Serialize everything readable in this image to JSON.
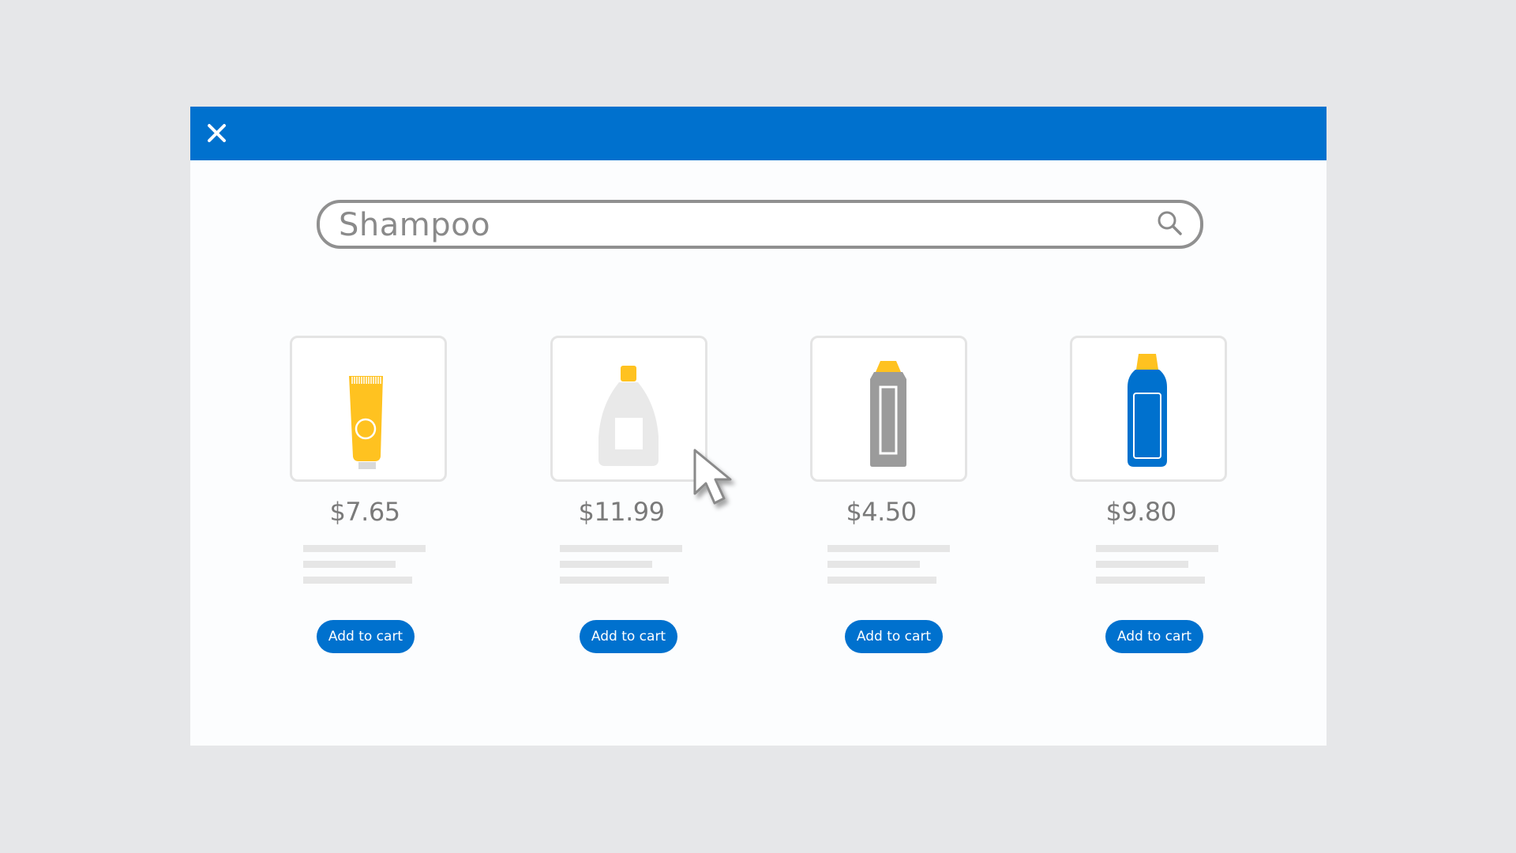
{
  "search": {
    "value": "Shampoo"
  },
  "products": [
    {
      "price": "$7.65",
      "button_label": "Add to cart",
      "icon": "yellow-tube-icon"
    },
    {
      "price": "$11.99",
      "button_label": "Add to cart",
      "icon": "white-bottle-icon"
    },
    {
      "price": "$4.50",
      "button_label": "Add to cart",
      "icon": "gray-bottle-icon"
    },
    {
      "price": "$9.80",
      "button_label": "Add to cart",
      "icon": "blue-bottle-icon"
    }
  ],
  "colors": {
    "brand_blue": "#0071ce",
    "accent_yellow": "#ffc220",
    "background": "#e6e7e9"
  },
  "icons": {
    "close": "close-icon",
    "search": "search-icon",
    "cursor": "mouse-pointer-icon"
  }
}
